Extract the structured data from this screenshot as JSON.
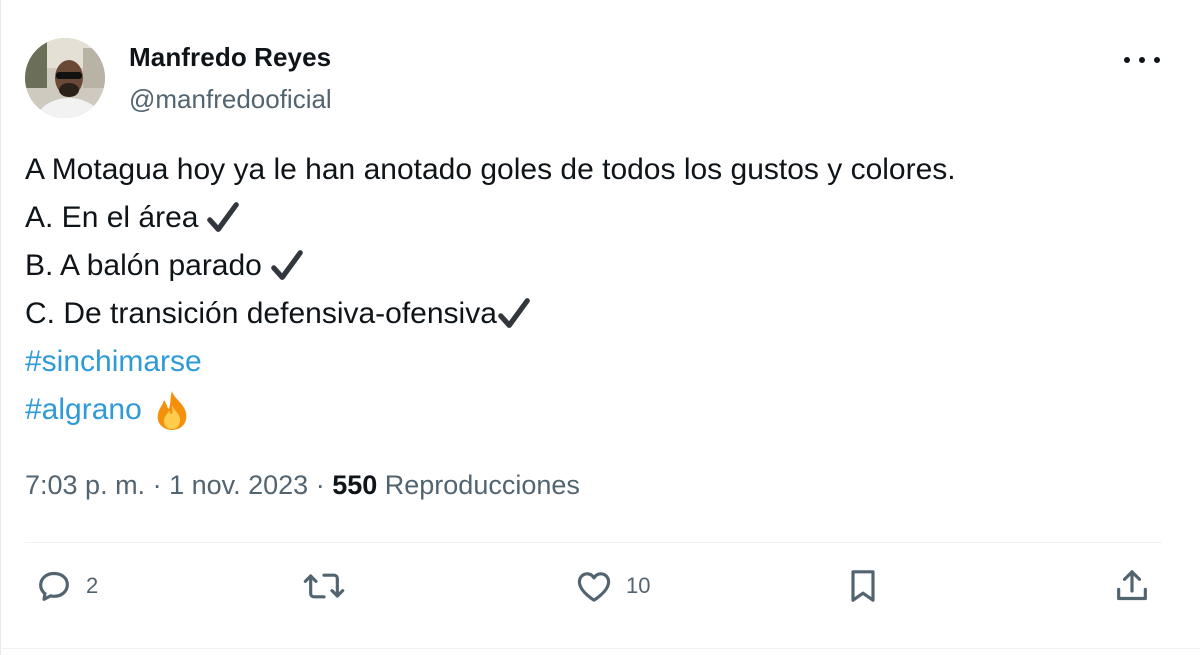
{
  "author": {
    "display_name": "Manfredo Reyes",
    "handle": "@manfredooficial"
  },
  "tweet": {
    "line1": "A Motagua hoy ya le han anotado goles de todos los gustos y colores.",
    "item_a": "A. En el área",
    "item_b": "B. A balón parado",
    "item_c": "C. De transición defensiva-ofensiva",
    "hashtag1": "#sinchimarse",
    "hashtag2": "#algrano"
  },
  "meta": {
    "time": "7:03 p. m.",
    "sep1": " · ",
    "date": "1 nov. 2023",
    "sep2": " · ",
    "views_count": "550",
    "views_label": " Reproducciones"
  },
  "actions": {
    "reply_count": "2",
    "retweet_count": "",
    "like_count": "10"
  },
  "icons": {
    "more": "more-horizontal-icon",
    "check": "heavy-check-mark-icon",
    "fire": "fire-emoji-icon",
    "reply": "reply-icon",
    "retweet": "retweet-icon",
    "like": "heart-icon",
    "bookmark": "bookmark-icon",
    "share": "share-icon"
  },
  "colors": {
    "text": "#0f1419",
    "secondary": "#536471",
    "hashtag": "#2e9ad6",
    "divider": "#eff3f4"
  }
}
